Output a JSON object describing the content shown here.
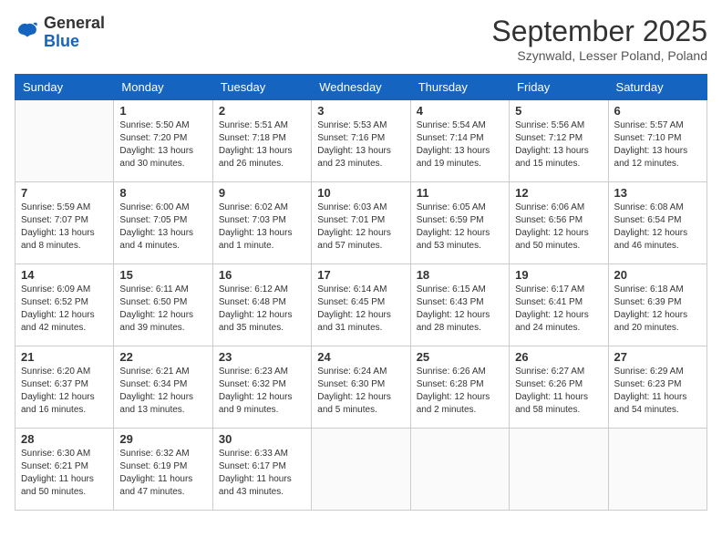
{
  "logo": {
    "general": "General",
    "blue": "Blue"
  },
  "title": "September 2025",
  "subtitle": "Szynwald, Lesser Poland, Poland",
  "days_header": [
    "Sunday",
    "Monday",
    "Tuesday",
    "Wednesday",
    "Thursday",
    "Friday",
    "Saturday"
  ],
  "weeks": [
    [
      {
        "day": "",
        "info": ""
      },
      {
        "day": "1",
        "info": "Sunrise: 5:50 AM\nSunset: 7:20 PM\nDaylight: 13 hours\nand 30 minutes."
      },
      {
        "day": "2",
        "info": "Sunrise: 5:51 AM\nSunset: 7:18 PM\nDaylight: 13 hours\nand 26 minutes."
      },
      {
        "day": "3",
        "info": "Sunrise: 5:53 AM\nSunset: 7:16 PM\nDaylight: 13 hours\nand 23 minutes."
      },
      {
        "day": "4",
        "info": "Sunrise: 5:54 AM\nSunset: 7:14 PM\nDaylight: 13 hours\nand 19 minutes."
      },
      {
        "day": "5",
        "info": "Sunrise: 5:56 AM\nSunset: 7:12 PM\nDaylight: 13 hours\nand 15 minutes."
      },
      {
        "day": "6",
        "info": "Sunrise: 5:57 AM\nSunset: 7:10 PM\nDaylight: 13 hours\nand 12 minutes."
      }
    ],
    [
      {
        "day": "7",
        "info": "Sunrise: 5:59 AM\nSunset: 7:07 PM\nDaylight: 13 hours\nand 8 minutes."
      },
      {
        "day": "8",
        "info": "Sunrise: 6:00 AM\nSunset: 7:05 PM\nDaylight: 13 hours\nand 4 minutes."
      },
      {
        "day": "9",
        "info": "Sunrise: 6:02 AM\nSunset: 7:03 PM\nDaylight: 13 hours\nand 1 minute."
      },
      {
        "day": "10",
        "info": "Sunrise: 6:03 AM\nSunset: 7:01 PM\nDaylight: 12 hours\nand 57 minutes."
      },
      {
        "day": "11",
        "info": "Sunrise: 6:05 AM\nSunset: 6:59 PM\nDaylight: 12 hours\nand 53 minutes."
      },
      {
        "day": "12",
        "info": "Sunrise: 6:06 AM\nSunset: 6:56 PM\nDaylight: 12 hours\nand 50 minutes."
      },
      {
        "day": "13",
        "info": "Sunrise: 6:08 AM\nSunset: 6:54 PM\nDaylight: 12 hours\nand 46 minutes."
      }
    ],
    [
      {
        "day": "14",
        "info": "Sunrise: 6:09 AM\nSunset: 6:52 PM\nDaylight: 12 hours\nand 42 minutes."
      },
      {
        "day": "15",
        "info": "Sunrise: 6:11 AM\nSunset: 6:50 PM\nDaylight: 12 hours\nand 39 minutes."
      },
      {
        "day": "16",
        "info": "Sunrise: 6:12 AM\nSunset: 6:48 PM\nDaylight: 12 hours\nand 35 minutes."
      },
      {
        "day": "17",
        "info": "Sunrise: 6:14 AM\nSunset: 6:45 PM\nDaylight: 12 hours\nand 31 minutes."
      },
      {
        "day": "18",
        "info": "Sunrise: 6:15 AM\nSunset: 6:43 PM\nDaylight: 12 hours\nand 28 minutes."
      },
      {
        "day": "19",
        "info": "Sunrise: 6:17 AM\nSunset: 6:41 PM\nDaylight: 12 hours\nand 24 minutes."
      },
      {
        "day": "20",
        "info": "Sunrise: 6:18 AM\nSunset: 6:39 PM\nDaylight: 12 hours\nand 20 minutes."
      }
    ],
    [
      {
        "day": "21",
        "info": "Sunrise: 6:20 AM\nSunset: 6:37 PM\nDaylight: 12 hours\nand 16 minutes."
      },
      {
        "day": "22",
        "info": "Sunrise: 6:21 AM\nSunset: 6:34 PM\nDaylight: 12 hours\nand 13 minutes."
      },
      {
        "day": "23",
        "info": "Sunrise: 6:23 AM\nSunset: 6:32 PM\nDaylight: 12 hours\nand 9 minutes."
      },
      {
        "day": "24",
        "info": "Sunrise: 6:24 AM\nSunset: 6:30 PM\nDaylight: 12 hours\nand 5 minutes."
      },
      {
        "day": "25",
        "info": "Sunrise: 6:26 AM\nSunset: 6:28 PM\nDaylight: 12 hours\nand 2 minutes."
      },
      {
        "day": "26",
        "info": "Sunrise: 6:27 AM\nSunset: 6:26 PM\nDaylight: 11 hours\nand 58 minutes."
      },
      {
        "day": "27",
        "info": "Sunrise: 6:29 AM\nSunset: 6:23 PM\nDaylight: 11 hours\nand 54 minutes."
      }
    ],
    [
      {
        "day": "28",
        "info": "Sunrise: 6:30 AM\nSunset: 6:21 PM\nDaylight: 11 hours\nand 50 minutes."
      },
      {
        "day": "29",
        "info": "Sunrise: 6:32 AM\nSunset: 6:19 PM\nDaylight: 11 hours\nand 47 minutes."
      },
      {
        "day": "30",
        "info": "Sunrise: 6:33 AM\nSunset: 6:17 PM\nDaylight: 11 hours\nand 43 minutes."
      },
      {
        "day": "",
        "info": ""
      },
      {
        "day": "",
        "info": ""
      },
      {
        "day": "",
        "info": ""
      },
      {
        "day": "",
        "info": ""
      }
    ]
  ]
}
